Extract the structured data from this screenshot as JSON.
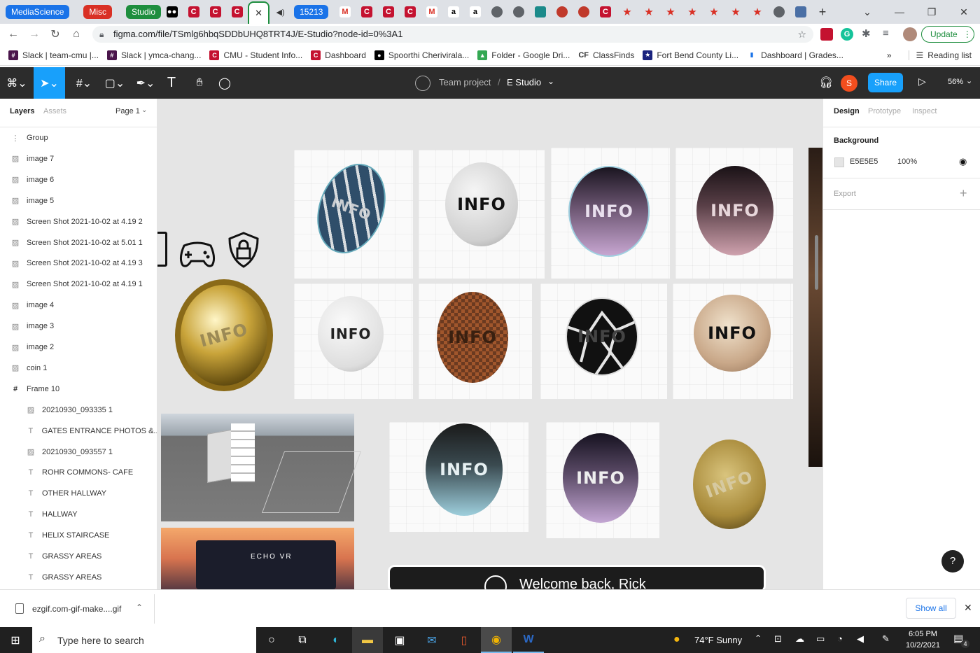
{
  "browser": {
    "tab_groups": [
      {
        "label": "MediaScience",
        "color": "#1a73e8"
      },
      {
        "label": "Misc",
        "color": "#d93025"
      },
      {
        "label": "Studio",
        "color": "#1e8e3e"
      }
    ],
    "pinned_count_label": "15213",
    "url": "figma.com/file/TSmlg6hbqSDDbUHQ8TRT4J/E-Studio?node-id=0%3A1",
    "update_label": "Update",
    "bookmarks": [
      "Slack | team-cmu |...",
      "Slack | ymca-chang...",
      "CMU - Student Info...",
      "Dashboard",
      "Spoorthi Cherivirala...",
      "Folder - Google Dri...",
      "ClassFinds",
      "Fort Bend County Li...",
      "Dashboard | Grades..."
    ],
    "reading_list": "Reading list",
    "more": "»",
    "cf_label": "CF"
  },
  "figma": {
    "breadcrumb_project": "Team project",
    "breadcrumb_sep": "/",
    "file_name": "E Studio",
    "avatar_initial": "S",
    "share_label": "Share",
    "zoom": "56%"
  },
  "left_panel": {
    "tabs": [
      "Layers",
      "Assets"
    ],
    "page": "Page 1",
    "layers": [
      {
        "name": "Group",
        "kind": "group",
        "indent": false
      },
      {
        "name": "image 7",
        "kind": "image",
        "indent": false
      },
      {
        "name": "image 6",
        "kind": "image",
        "indent": false
      },
      {
        "name": "image 5",
        "kind": "image",
        "indent": false
      },
      {
        "name": "Screen Shot 2021-10-02 at 4.19 2",
        "kind": "image",
        "indent": false
      },
      {
        "name": "Screen Shot 2021-10-02 at 5.01 1",
        "kind": "image",
        "indent": false
      },
      {
        "name": "Screen Shot 2021-10-02 at 4.19 3",
        "kind": "image",
        "indent": false
      },
      {
        "name": "Screen Shot 2021-10-02 at 4.19 1",
        "kind": "image",
        "indent": false
      },
      {
        "name": "image 4",
        "kind": "image",
        "indent": false
      },
      {
        "name": "image 3",
        "kind": "image",
        "indent": false
      },
      {
        "name": "image 2",
        "kind": "image",
        "indent": false
      },
      {
        "name": "coin 1",
        "kind": "image",
        "indent": false
      },
      {
        "name": "Frame 10",
        "kind": "frame",
        "indent": false
      },
      {
        "name": "20210930_093335 1",
        "kind": "image",
        "indent": true
      },
      {
        "name": "GATES ENTRANCE PHOTOS &...",
        "kind": "text",
        "indent": true
      },
      {
        "name": "20210930_093557 1",
        "kind": "image",
        "indent": true
      },
      {
        "name": "ROHR COMMONS- CAFE",
        "kind": "text",
        "indent": true
      },
      {
        "name": "OTHER HALLWAY",
        "kind": "text",
        "indent": true
      },
      {
        "name": "HALLWAY",
        "kind": "text",
        "indent": true
      },
      {
        "name": "HELIX STAIRCASE",
        "kind": "text",
        "indent": true
      },
      {
        "name": "GRASSY AREAS",
        "kind": "text",
        "indent": true
      },
      {
        "name": "GRASSY AREAS",
        "kind": "text",
        "indent": true
      }
    ]
  },
  "canvas": {
    "coin_label": "INFO",
    "vr_title": "ECHO VR",
    "welcome": "Welcome back, Rick"
  },
  "right_panel": {
    "tabs": [
      "Design",
      "Prototype",
      "Inspect"
    ],
    "background_label": "Background",
    "bg_hex": "E5E5E5",
    "bg_opacity": "100%",
    "export_label": "Export",
    "help": "?"
  },
  "download": {
    "file": "ezgif.com-gif-make....gif",
    "show_all": "Show all"
  },
  "taskbar": {
    "search_placeholder": "Type here to search",
    "weather": "74°F  Sunny",
    "time": "6:05 PM",
    "date": "10/2/2021",
    "notif_count": "4"
  }
}
